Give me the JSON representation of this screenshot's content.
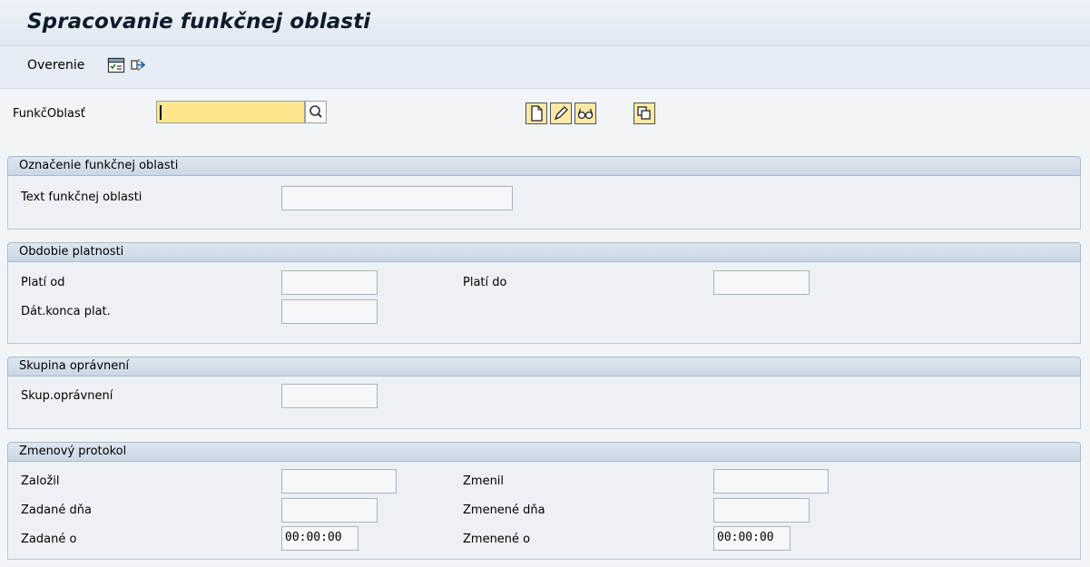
{
  "title": "Spracovanie funkčnej oblasti",
  "toolbar": {
    "overenie_label": "Overenie",
    "icons": [
      "checklist-icon",
      "transfer-icon"
    ]
  },
  "header": {
    "functional_area_label": "FunkčOblasť",
    "functional_area_value": "",
    "buttons": [
      "create-icon",
      "change-icon",
      "display-icon",
      "copy-icon"
    ]
  },
  "sections": {
    "designation": {
      "title": "Označenie funkčnej oblasti",
      "text_label": "Text funkčnej oblasti",
      "text_value": ""
    },
    "validity": {
      "title": "Obdobie platnosti",
      "valid_from_label": "Platí od",
      "valid_from_value": "",
      "valid_to_label": "Platí do",
      "valid_to_value": "",
      "end_date_label": "Dát.konca plat.",
      "end_date_value": ""
    },
    "auth": {
      "title": "Skupina oprávnení",
      "auth_label": "Skup.oprávnení",
      "auth_value": ""
    },
    "changelog": {
      "title": "Zmenový protokol",
      "created_by_label": "Založil",
      "created_by_value": "",
      "changed_by_label": "Zmenil",
      "changed_by_value": "",
      "created_on_label": "Zadané dňa",
      "created_on_value": "",
      "changed_on_label": "Zmenené dňa",
      "changed_on_value": "",
      "created_at_label": "Zadané o",
      "created_at_value": "00:00:00",
      "changed_at_label": "Zmenené o",
      "changed_at_value": "00:00:00"
    }
  },
  "colors": {
    "key_field": "#ffe58d",
    "group_header": "#cad7e4",
    "background": "#f2f5f8"
  }
}
